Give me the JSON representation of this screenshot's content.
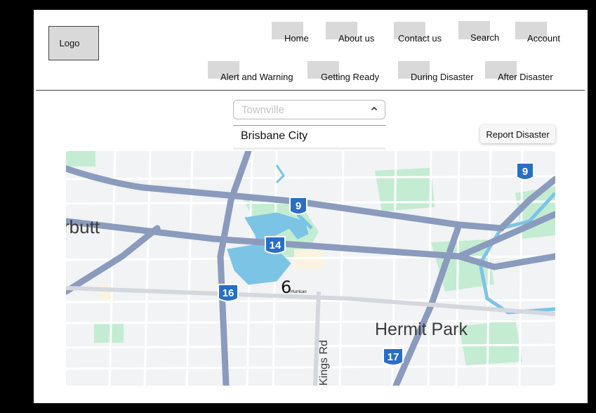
{
  "header": {
    "logo_label": "Logo",
    "nav_primary": [
      {
        "label": "Home"
      },
      {
        "label": "About us"
      },
      {
        "label": "Contact us"
      },
      {
        "label": "Search"
      },
      {
        "label": "Account"
      }
    ],
    "nav_secondary": [
      {
        "label": "Alert and Warning"
      },
      {
        "label": "Getting Ready"
      },
      {
        "label": "During Disaster"
      },
      {
        "label": "After Disaster"
      }
    ]
  },
  "location_select": {
    "selected": "Townville",
    "options": [
      "Brisbane City"
    ]
  },
  "report_button_label": "Report Disaster",
  "map": {
    "places": {
      "left_suburb": "rbutt",
      "suburb": "Hermit Park",
      "street": "Kings Rd"
    },
    "shields": [
      "9",
      "9",
      "14",
      "16",
      "17"
    ],
    "marker": {
      "glyph": "6",
      "label": "Hurrican"
    },
    "colors": {
      "road_major": "#8a9bbd",
      "road_minor": "#ffffff",
      "park": "#c3ecd2",
      "water": "#7cc4e6",
      "shield": "#2a6ec4",
      "building": "#fbf3e0"
    }
  }
}
